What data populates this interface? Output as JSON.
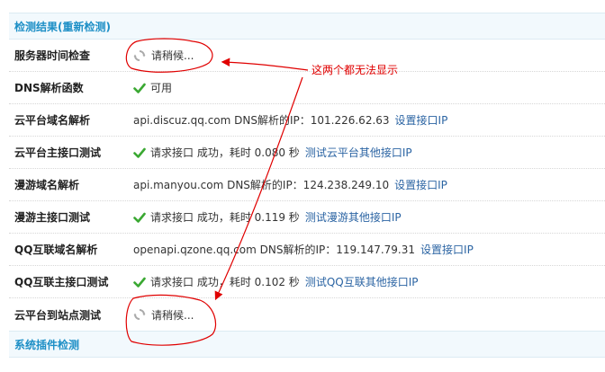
{
  "section1": {
    "title": "检测结果(重新检测)"
  },
  "rows": [
    {
      "name": "服务器时间检查",
      "status_text": "请稍候..."
    },
    {
      "name": "DNS解析函数",
      "status_text": "可用"
    },
    {
      "name": "云平台域名解析",
      "text": "api.discuz.qq.com DNS解析的IP：101.226.62.63",
      "link": "设置接口IP"
    },
    {
      "name": "云平台主接口测试",
      "text": "请求接口  成功，耗时  0.080 秒",
      "link": "测试云平台其他接口IP"
    },
    {
      "name": "漫游域名解析",
      "text": "api.manyou.com DNS解析的IP：124.238.249.10",
      "link": "设置接口IP"
    },
    {
      "name": "漫游主接口测试",
      "text": "请求接口  成功，耗时  0.119 秒",
      "link": "测试漫游其他接口IP"
    },
    {
      "name": "QQ互联域名解析",
      "text": "openapi.qzone.qq.com DNS解析的IP：119.147.79.31",
      "link": "设置接口IP"
    },
    {
      "name": "QQ互联主接口测试",
      "text": "请求接口  成功，耗时  0.102 秒",
      "link": "测试QQ互联其他接口IP"
    },
    {
      "name": "云平台到站点测试",
      "status_text": "请稍候..."
    }
  ],
  "section2": {
    "title": "系统插件检测"
  },
  "annotation": {
    "text": "这两个都无法显示",
    "color": "#e00000"
  },
  "icons": {
    "check": "green-check-icon",
    "spinner": "refresh-spinner-icon"
  }
}
